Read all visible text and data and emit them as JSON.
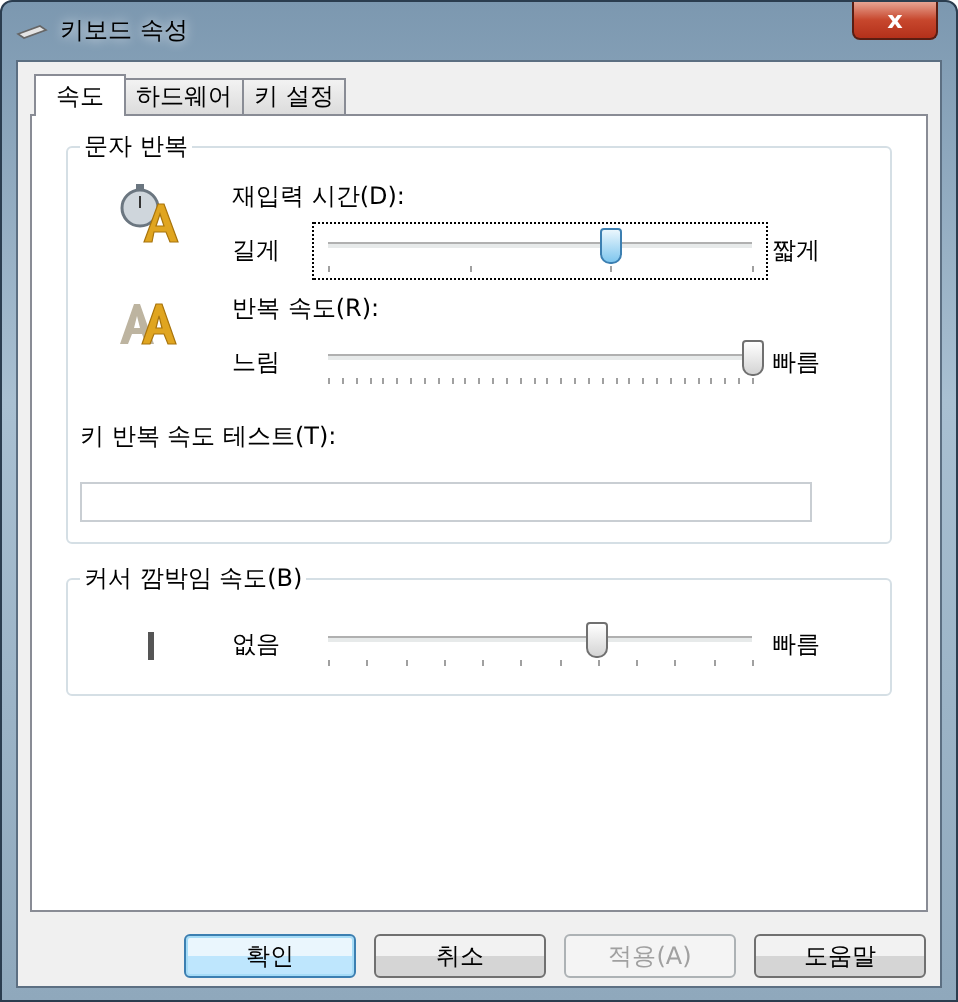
{
  "window": {
    "title": "키보드 속성",
    "close": "x"
  },
  "tabs": [
    {
      "label": "속도",
      "selected": true
    },
    {
      "label": "하드웨어",
      "selected": false
    },
    {
      "label": "키 설정",
      "selected": false
    }
  ],
  "repeat_group": {
    "title": "문자 반복",
    "sliders": [
      {
        "kind": "delay",
        "label": "재입력 시간(D):",
        "min_label": "길게",
        "max_label": "짧게",
        "level": 0.667,
        "focused": true
      },
      {
        "kind": "rate",
        "label": "반복 속도(R):",
        "min_label": "느림",
        "max_label": "빠름",
        "level": 1.0,
        "focused": false
      }
    ],
    "test_label": "키 반복 속도 테스트(T):"
  },
  "cursor_group": {
    "title": "커서 깜박임 속도(B)",
    "slider": {
      "kind": "blink",
      "min_label": "없음",
      "max_label": "빠름",
      "level": 0.636,
      "focused": false
    }
  },
  "buttons": [
    {
      "label": "확인",
      "default": true,
      "disabled": false
    },
    {
      "label": "취소",
      "default": false,
      "disabled": false
    },
    {
      "label": "적용(A)",
      "default": false,
      "disabled": true
    },
    {
      "label": "도움말",
      "default": false,
      "disabled": false
    }
  ]
}
